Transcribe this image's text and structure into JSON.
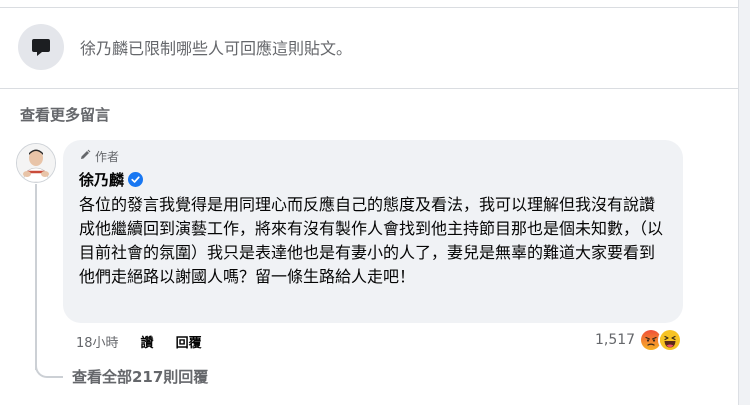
{
  "restriction_notice": {
    "text": "徐乃麟已限制哪些人可回應這則貼文。",
    "icon": "speech-bubble-icon"
  },
  "comments_section": {
    "view_more_label": "查看更多留言"
  },
  "comment": {
    "author_badge": "作者",
    "author_name": "徐乃麟",
    "verified": true,
    "text": "各位的發言我覺得是用同理心而反應自己的態度及看法，我可以理解但我沒有說讚成他繼續回到演藝工作，將來有沒有製作人會找到他主持節目那也是個未知數，（以目前社會的氛圍）我只是表達他也是有妻小的人了，妻兒是無辜的難道大家要看到他們走絕路以謝國人嗎？留一條生路給人走吧！",
    "time": "18小時",
    "like_label": "讚",
    "reply_label": "回覆",
    "reaction_count": "1,517",
    "reactions": [
      "angry-emoji",
      "haha-emoji"
    ],
    "view_replies_label": "查看全部217則回覆"
  },
  "colors": {
    "secondary_text": "#65676b",
    "bubble_bg": "#f0f2f5",
    "verified_blue": "#1877f2",
    "angry": "#e9710f",
    "haha": "#f7b125"
  }
}
